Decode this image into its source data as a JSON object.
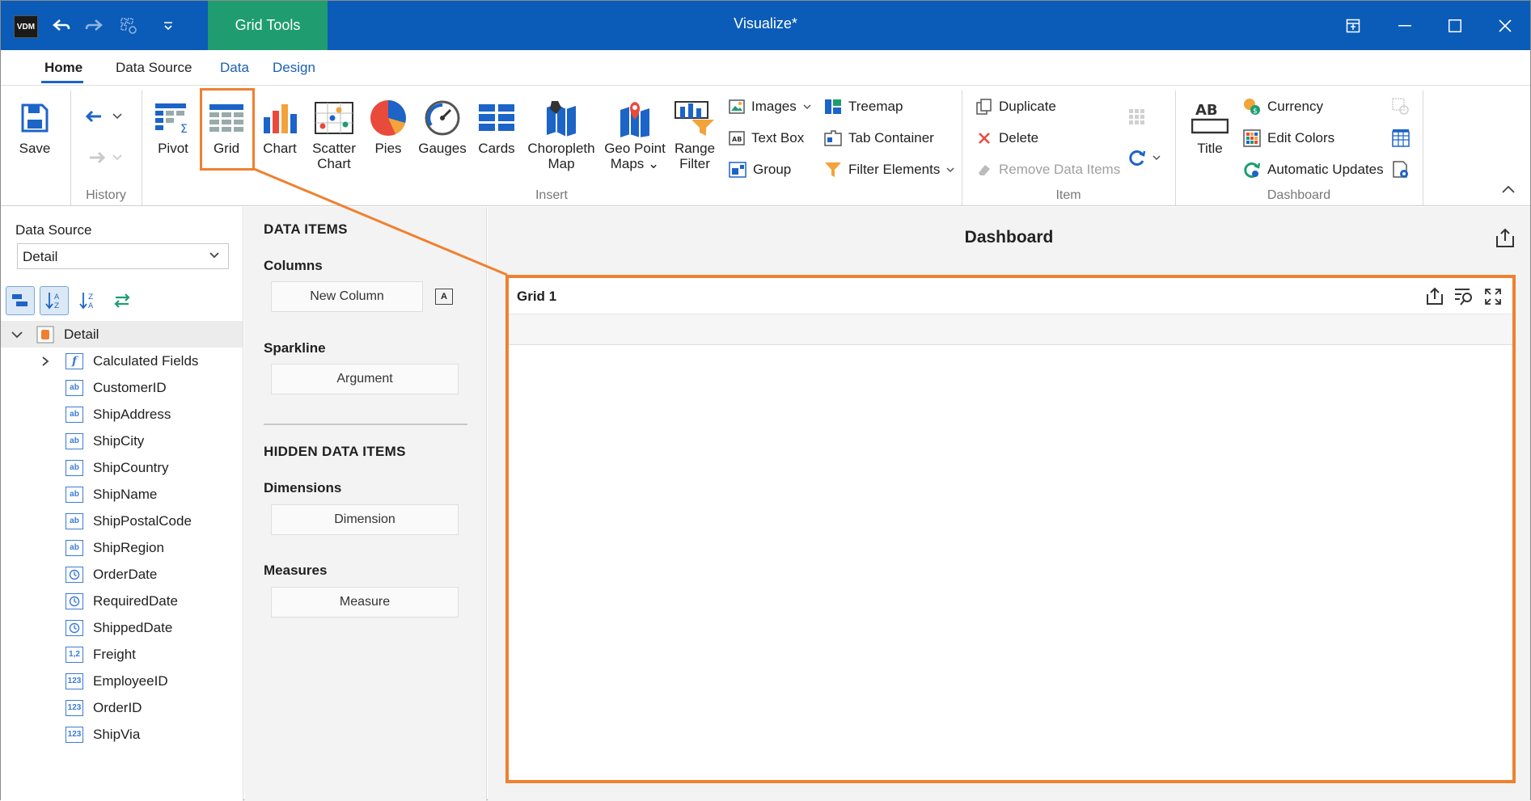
{
  "titlebar": {
    "app_logo": "VDM",
    "context_tab": "Grid Tools",
    "title": "Visualize*",
    "undo_icon": "undo-icon",
    "redo_icon": "redo-icon"
  },
  "tabs": [
    {
      "label": "Home",
      "active": true
    },
    {
      "label": "Data Source"
    },
    {
      "label": "Data"
    },
    {
      "label": "Design"
    }
  ],
  "ribbon": {
    "save": "Save",
    "history_group": "History",
    "insert": {
      "pivot": "Pivot",
      "grid": "Grid",
      "chart": "Chart",
      "scatter": "Scatter Chart",
      "pies": "Pies",
      "gauges": "Gauges",
      "cards": "Cards",
      "choropleth": "Choropleth Map",
      "geopoint": "Geo Point Maps",
      "rangefilter": "Range Filter",
      "images": "Images",
      "textbox": "Text Box",
      "group": "Group",
      "treemap": "Treemap",
      "tabcontainer": "Tab Container",
      "filterelements": "Filter Elements"
    },
    "insert_group": "Insert",
    "item": {
      "duplicate": "Duplicate",
      "delete": "Delete",
      "remove": "Remove Data Items"
    },
    "item_group": "Item",
    "dashboard": {
      "title": "Title",
      "currency": "Currency",
      "editcolors": "Edit Colors",
      "autoupdates": "Automatic Updates"
    },
    "dashboard_group": "Dashboard"
  },
  "left": {
    "ds_label": "Data Source",
    "ds_value": "Detail",
    "root": "Detail",
    "fields": [
      {
        "name": "Calculated Fields",
        "icon": "f",
        "expand": true
      },
      {
        "name": "CustomerID",
        "icon": "ab"
      },
      {
        "name": "ShipAddress",
        "icon": "ab"
      },
      {
        "name": "ShipCity",
        "icon": "ab"
      },
      {
        "name": "ShipCountry",
        "icon": "ab"
      },
      {
        "name": "ShipName",
        "icon": "ab"
      },
      {
        "name": "ShipPostalCode",
        "icon": "ab"
      },
      {
        "name": "ShipRegion",
        "icon": "ab"
      },
      {
        "name": "OrderDate",
        "icon": "clock"
      },
      {
        "name": "RequiredDate",
        "icon": "clock"
      },
      {
        "name": "ShippedDate",
        "icon": "clock"
      },
      {
        "name": "Freight",
        "icon": "1,2"
      },
      {
        "name": "EmployeeID",
        "icon": "123"
      },
      {
        "name": "OrderID",
        "icon": "123"
      },
      {
        "name": "ShipVia",
        "icon": "123"
      }
    ]
  },
  "middle": {
    "data_items": "DATA ITEMS",
    "columns": "Columns",
    "new_column": "New Column",
    "sparkline": "Sparkline",
    "argument": "Argument",
    "hidden": "HIDDEN DATA ITEMS",
    "dimensions": "Dimensions",
    "dimension": "Dimension",
    "measures": "Measures",
    "measure": "Measure"
  },
  "dashboard": {
    "title": "Dashboard",
    "grid_title": "Grid 1"
  },
  "colors": {
    "titlebar": "#0a5cb8",
    "context_tab": "#1f9d70",
    "highlight": "#f08030"
  }
}
